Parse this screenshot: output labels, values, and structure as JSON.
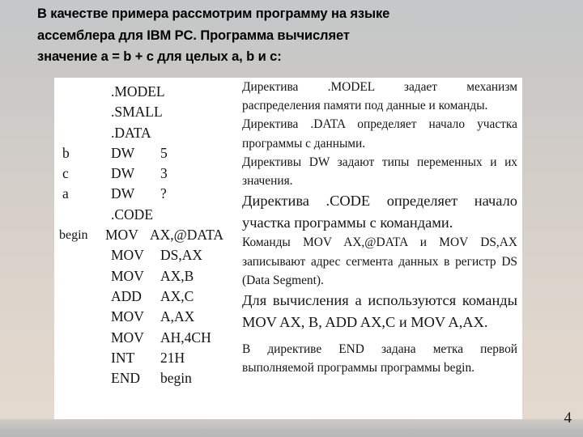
{
  "slide": {
    "heading_lines": [
      "В качестве примера рассмотрим программу на языке",
      "ассемблера для IBM PC. Программа вычисляет",
      "значение a = b + c для целых a, b и c:"
    ],
    "page_number": "4",
    "colors": {
      "background_top": "#c5c7c8",
      "background_bottom": "#e3d9ce",
      "bottom_band": "#b7b7b7",
      "panel": "#ffffff",
      "text": "#000000"
    }
  },
  "code_listing": {
    "rows": [
      {
        "label": "",
        "op": ".MODEL",
        "arg": ""
      },
      {
        "label": "",
        "op": ".SMALL",
        "arg": ""
      },
      {
        "label": "",
        "op": ".DATA",
        "arg": ""
      },
      {
        "label": "b",
        "op": "DW",
        "arg": "5"
      },
      {
        "label": "c",
        "op": "DW",
        "arg": "3"
      },
      {
        "label": "a",
        "op": "DW",
        "arg": "?"
      },
      {
        "label": "",
        "op": ".CODE",
        "arg": ""
      },
      {
        "label": "begin",
        "op": "MOV",
        "arg": "AX,@DATA"
      },
      {
        "label": "",
        "op": "MOV",
        "arg": "DS,AX"
      },
      {
        "label": "",
        "op": "MOV",
        "arg": "AX,B"
      },
      {
        "label": "",
        "op": "ADD",
        "arg": "AX,C"
      },
      {
        "label": "",
        "op": "MOV",
        "arg": "A,AX"
      },
      {
        "label": "",
        "op": "MOV",
        "arg": "AH,4CH"
      },
      {
        "label": "",
        "op": "INT",
        "arg": "21H"
      },
      {
        "label": "",
        "op": "END",
        "arg": "begin"
      }
    ]
  },
  "explanation": {
    "paragraphs": [
      "Директива .MODEL задает механизм распределения памяти под данные и команды.",
      "Директива .DATA определяет начало участка программы с данными.",
      "Директивы DW задают типы переменных и их значения.",
      "Директива .CODE определяет начало участка программы с командами.",
      "Команды MOV AX,@DATA и MOV DS,AX записывают адрес сегмента данных в регистр DS (Data Segment).",
      "Для вычисления a используются команды MOV AX, B, ADD AX,C и MOV A,AX.",
      "В директиве END задана метка первой выполняемой программы программы begin."
    ]
  }
}
